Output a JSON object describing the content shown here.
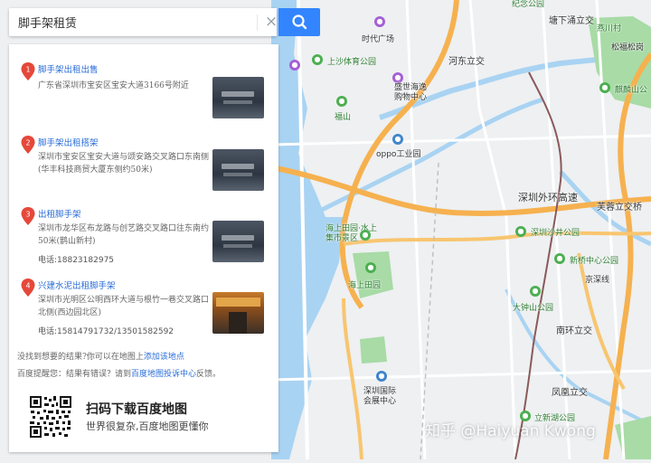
{
  "search": {
    "value": "脚手架租赁",
    "placeholder": "",
    "clear_label": "×"
  },
  "results": [
    {
      "num": "1",
      "title": "脚手架出租出售",
      "address": "广东省深圳市宝安区宝安大道3166号附近",
      "phone": ""
    },
    {
      "num": "2",
      "title": "脚手架出租搭架",
      "address": "深圳市宝安区宝安大道与颂安路交叉路口东南侧(华丰科技商贸大厦东侧约50米)",
      "phone": ""
    },
    {
      "num": "3",
      "title": "出租脚手架",
      "address": "深圳市龙华区布龙路与创艺路交叉路口往东南约50米(鹊山新村)",
      "phone": "电话:18823182975"
    },
    {
      "num": "4",
      "title": "兴建水泥出租脚手架",
      "address": "深圳市光明区公明西环大道与根竹一巷交叉路口北侧(西边园北区)",
      "phone": "电话:15814791732/13501582592"
    }
  ],
  "not_found": {
    "text": "没找到想要的结果?你可以在地图上",
    "link": "添加该地点"
  },
  "tip": {
    "prefix": "百度提醒您：结果有错误？请到",
    "link": "百度地图投诉中心",
    "suffix": "反馈。"
  },
  "qr": {
    "title": "扫码下载百度地图",
    "subtitle": "世界很复杂,百度地图更懂你"
  },
  "map_labels": {
    "time_square": "时代广场",
    "shangsha_park": "上沙体育公园",
    "shengshi_mall": "盛世海逸\n购物中心",
    "hedong": "河东立交",
    "fushan": "福山",
    "oppo": "oppo工业园",
    "tangxia": "塘下涌立交",
    "yanchuan": "燕川村",
    "songgang": "松福松岗",
    "qilin": "麒麟山公",
    "waihuan": "深圳外环高速",
    "furong": "芙蓉立交桥",
    "haishang_leyuan": "海上田园·水上\n集市景区",
    "shasha_park": "深圳沙井公园",
    "haishang_tianyuan": "海上田园",
    "xinqiao_park": "新桥中心公园",
    "jingshen": "京深线",
    "dazhongshan": "大钟山公园",
    "nanhuan": "南环立交",
    "expo": "深圳国际\n会展中心",
    "fengguan": "凤凰立交",
    "lixin_lake": "立新湖公园",
    "jinian": "纪念公园",
    "watermark": "知乎 @Haiyuan Kwong"
  },
  "colors": {
    "accent": "#3385ff",
    "link": "#2a6dd8",
    "marker": "#e5483a",
    "sea": "#a9d3f2",
    "expressway": "#f6b14f",
    "park": "#a8dba6"
  }
}
